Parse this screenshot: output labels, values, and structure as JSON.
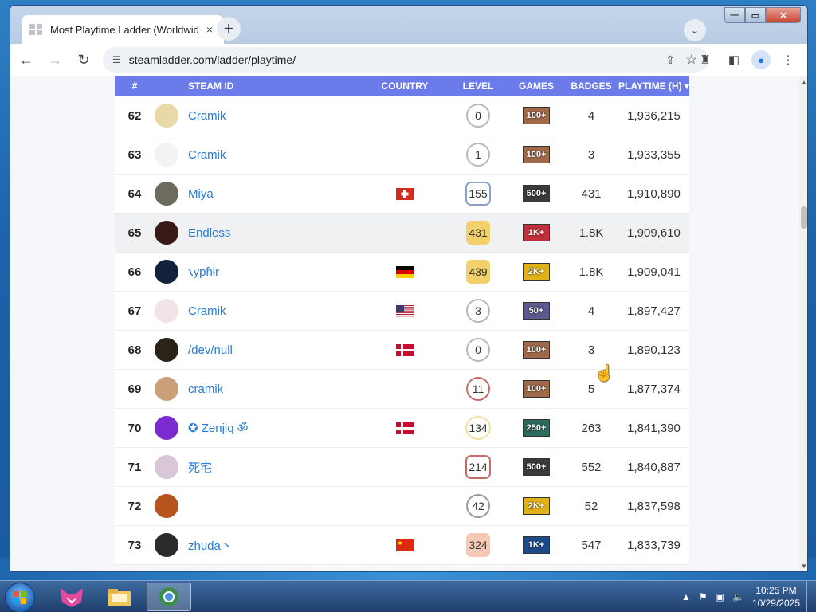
{
  "browser": {
    "tab_title": "Most Playtime Ladder (Worldwid",
    "tab_close": "×",
    "new_tab": "+",
    "tab_search": "⌄",
    "url": "steamladder.com/ladder/playtime/",
    "back": "←",
    "forward": "→",
    "reload": "↻",
    "window_controls": {
      "minimize": "—",
      "maximize": "▭",
      "close": "✕"
    }
  },
  "table": {
    "headers": {
      "rank": "#",
      "steam_id": "STEAM ID",
      "country": "COUNTRY",
      "level": "LEVEL",
      "games": "GAMES",
      "badges": "BADGES",
      "playtime": "PLAYTIME (H) ▾"
    },
    "rows": [
      {
        "rank": "62",
        "name": "Cramik",
        "avatar_color": "#e9d9a8",
        "flag": "",
        "level": "0",
        "level_style": "circle",
        "level_color": "#b8b8b8",
        "games_badge": "100+",
        "games_color": "#a0694a",
        "badges": "4",
        "playtime": "1,936,215",
        "highlight": false
      },
      {
        "rank": "63",
        "name": "Cramik",
        "avatar_color": "#f3f3f3",
        "flag": "",
        "level": "1",
        "level_style": "circle",
        "level_color": "#b8b8b8",
        "games_badge": "100+",
        "games_color": "#a0694a",
        "badges": "3",
        "playtime": "1,933,355",
        "highlight": false
      },
      {
        "rank": "64",
        "name": "Miya",
        "avatar_color": "#6d6a5f",
        "flag": "ch",
        "level": "155",
        "level_style": "hex",
        "level_color": "#8aa0c4",
        "games_badge": "500+",
        "games_color": "#3a3a3a",
        "badges": "431",
        "playtime": "1,910,890",
        "highlight": false
      },
      {
        "rank": "65",
        "name": "Endless",
        "avatar_color": "#3a1a16",
        "flag": "",
        "level": "431",
        "level_style": "soft",
        "level_color": "#f2d06b",
        "games_badge": "1K+",
        "games_color": "#c0303a",
        "badges": "1.8K",
        "playtime": "1,909,610",
        "highlight": true
      },
      {
        "rank": "66",
        "name": "𐑯ypɦɨr",
        "avatar_color": "#12223d",
        "flag": "de",
        "level": "439",
        "level_style": "soft",
        "level_color": "#f2d06b",
        "games_badge": "2K+",
        "games_color": "#e0b21a",
        "badges": "1.8K",
        "playtime": "1,909,041",
        "highlight": false
      },
      {
        "rank": "67",
        "name": "Cramik",
        "avatar_color": "#f2e3e6",
        "flag": "us",
        "level": "3",
        "level_style": "circle",
        "level_color": "#b8b8b8",
        "games_badge": "50+",
        "games_color": "#5b5a8e",
        "badges": "4",
        "playtime": "1,897,427",
        "highlight": false
      },
      {
        "rank": "68",
        "name": "/dev/null",
        "avatar_color": "#2a2418",
        "flag": "dk",
        "level": "0",
        "level_style": "circle",
        "level_color": "#b8b8b8",
        "games_badge": "100+",
        "games_color": "#a0694a",
        "badges": "3",
        "playtime": "1,890,123",
        "highlight": false
      },
      {
        "rank": "69",
        "name": "cramik",
        "avatar_color": "#c9a07a",
        "flag": "",
        "level": "11",
        "level_style": "circle",
        "level_color": "#c96a6a",
        "games_badge": "100+",
        "games_color": "#a0694a",
        "badges": "5",
        "playtime": "1,877,374",
        "highlight": false
      },
      {
        "rank": "70",
        "name": "✪ Zenjiq ॐ",
        "avatar_color": "#7a2bd1",
        "flag": "dk",
        "level": "134",
        "level_style": "circle",
        "level_color": "#f2e2a0",
        "games_badge": "250+",
        "games_color": "#2c6b5e",
        "badges": "263",
        "playtime": "1,841,390",
        "highlight": false
      },
      {
        "rank": "71",
        "name": "死宅",
        "avatar_color": "#d9c6d6",
        "flag": "",
        "level": "214",
        "level_style": "hex",
        "level_color": "#c96a6a",
        "games_badge": "500+",
        "games_color": "#3a3a3a",
        "badges": "552",
        "playtime": "1,840,887",
        "highlight": false
      },
      {
        "rank": "72",
        "name": "",
        "avatar_color": "#b5541c",
        "flag": "",
        "level": "42",
        "level_style": "circle",
        "level_color": "#9a9a9a",
        "games_badge": "2K+",
        "games_color": "#e0b21a",
        "badges": "52",
        "playtime": "1,837,598",
        "highlight": false
      },
      {
        "rank": "73",
        "name": "zhuda丶",
        "avatar_color": "#2b2b2b",
        "flag": "cn",
        "level": "324",
        "level_style": "soft",
        "level_color": "#f4c9b6",
        "games_badge": "1K+",
        "games_color": "#1d4a8a",
        "badges": "547",
        "playtime": "1,833,739",
        "highlight": false
      }
    ]
  },
  "taskbar": {
    "time": "10:25 PM",
    "date": "10/29/2025"
  }
}
